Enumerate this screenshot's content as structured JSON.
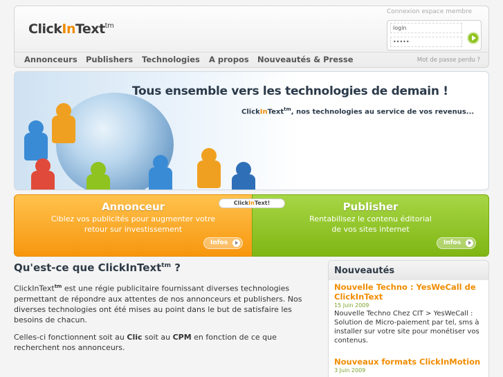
{
  "header": {
    "logo": {
      "part1": "Click",
      "part2": "In",
      "part3": "Text",
      "tm": "tm"
    },
    "login_title": "Connexion espace membre",
    "login_placeholder": "login",
    "password_value": "•••••",
    "forgot_password": "Mot de passe perdu ?",
    "nav": [
      "Annonceurs",
      "Publishers",
      "Technologies",
      "A propos",
      "Nouveautés & Presse"
    ]
  },
  "banner": {
    "title": "Tous ensemble vers les technologies de demain !",
    "sub_brand_1": "Click",
    "sub_brand_2": "In",
    "sub_brand_3": "Text",
    "sub_tm": "tm",
    "sub_text": ", nos technologies au service de vos revenus..."
  },
  "boxes": {
    "badge": {
      "part1": "Click",
      "part2": "In",
      "part3": "Text!"
    },
    "annonceur": {
      "title": "Annonceur",
      "line1": "Ciblez vos publicités pour augmenter votre",
      "line2": "retour sur investissement",
      "button": "Infos"
    },
    "publisher": {
      "title": "Publisher",
      "line1": "Rentabilisez le contenu éditorial",
      "line2": "de vos sites internet",
      "button": "Infos"
    }
  },
  "main": {
    "title": "Qu'est-ce que ClickInText",
    "title_tm": "tm",
    "title_end": " ?",
    "p1_brand": "ClickInText",
    "p1_tm": "tm",
    "p1_text": " est une régie publicitaire fournissant diverses technologies permettant de répondre aux attentes de nos annonceurs et publishers. Nos diverses technologies ont été mises au point dans le but de satisfaire les besoins de chacun.",
    "p2_a": "Celles-ci fonctionnent soit au ",
    "p2_clic": "Clic",
    "p2_b": " soit au ",
    "p2_cpm": "CPM",
    "p2_c": " en fonction de ce que recherchent nos annonceurs."
  },
  "news": {
    "title": "Nouveautés",
    "items": [
      {
        "headline": "Nouvelle Techno : YesWeCall de ClickInText",
        "date": "15 Juin 2009",
        "text": "Nouvelle Techno Chez CIT > YesWeCall : Solution de Micro-paiement par tel, sms à installer sur votre site pour monétiser vos contenus."
      },
      {
        "headline": "Nouveaux formats ClickInMotion",
        "date": "3 Juin 2009",
        "text": ""
      }
    ]
  },
  "colors": {
    "accent_orange": "#f08c00",
    "accent_green": "#8fc31f"
  }
}
